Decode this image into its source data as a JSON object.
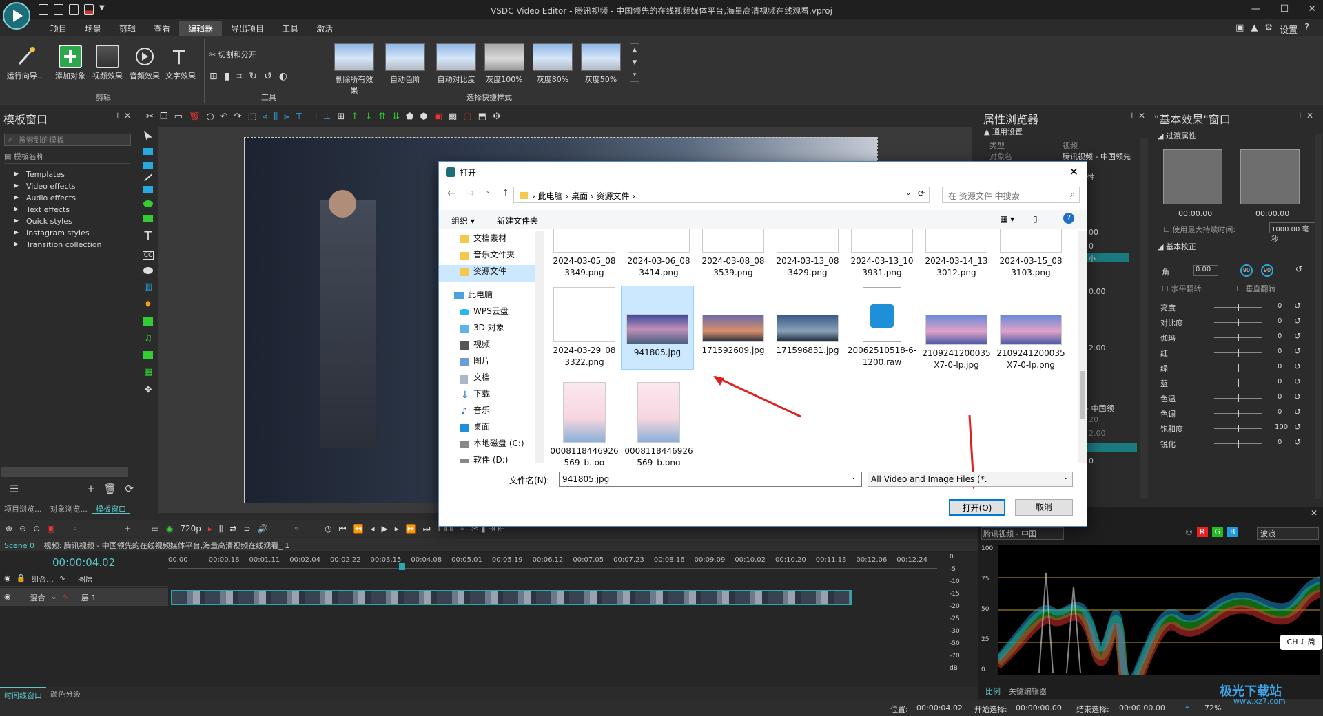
{
  "titlebar": {
    "title": "VSDC Video Editor - 腾讯视频 - 中国领先的在线视频媒体平台,海量高清视频在线观看.vproj",
    "settings": "设置"
  },
  "menu": [
    {
      "label": "项目"
    },
    {
      "label": "场景"
    },
    {
      "label": "剪辑"
    },
    {
      "label": "查看"
    },
    {
      "label": "编辑器"
    },
    {
      "label": "导出项目"
    },
    {
      "label": "工具"
    },
    {
      "label": "激活"
    }
  ],
  "ribbon": {
    "wizard": "运行向导...",
    "add_object": "添加对象",
    "video_effects": "视频效果",
    "audio_effects": "音频效果",
    "text_effects": "文字效果",
    "edit_group": "剪辑",
    "cut_split": "切割和分开",
    "tools_group": "工具",
    "styles_group": "选择快捷样式",
    "styles": [
      {
        "label": "删除所有效果"
      },
      {
        "label": "自动色阶"
      },
      {
        "label": "自动对比度"
      },
      {
        "label": "灰度100%"
      },
      {
        "label": "灰度80%"
      },
      {
        "label": "灰度50%"
      }
    ]
  },
  "template_panel": {
    "title": "模板窗口",
    "search_placeholder": "搜索到的模板",
    "column": "模板名称",
    "items": [
      {
        "label": "Templates"
      },
      {
        "label": "Video effects"
      },
      {
        "label": "Audio effects"
      },
      {
        "label": "Text effects"
      },
      {
        "label": "Quick styles"
      },
      {
        "label": "Instagram styles"
      },
      {
        "label": "Transition collection"
      }
    ],
    "tabs": [
      "项目浏览...",
      "对象浏览...",
      "模板窗口"
    ]
  },
  "properties": {
    "title": "属性浏览器",
    "section": "通用设置",
    "k1": "类型",
    "v1": "视频",
    "k2": "对象名",
    "v2": "腾讯视频 - 中国领先",
    "v3": "性",
    "t1": "00",
    "t2": "0",
    "t3": "小",
    "t4": "0.00",
    "t5": "2.00",
    "t6": "- 中国领",
    "t7": "20",
    "t8": "2.00",
    "t9": "0"
  },
  "basic_effects": {
    "title": "\"基本效果\"窗口",
    "transition": "过渡属性",
    "time1": "00:00.00",
    "time2": "00:00.00",
    "max_label": "使用最大持续时间:",
    "max_value": "1000.00 毫秒",
    "correction": "基本校正",
    "angle_label": "角",
    "angle_value": "0.00",
    "r1": "90",
    "r2": "90",
    "flip_h": "水平翻转",
    "flip_v": "垂直翻转",
    "sliders": [
      {
        "label": "亮度",
        "value": "0"
      },
      {
        "label": "对比度",
        "value": "0"
      },
      {
        "label": "伽玛",
        "value": "0"
      },
      {
        "label": "红",
        "value": "0"
      },
      {
        "label": "绿",
        "value": "0"
      },
      {
        "label": "蓝",
        "value": "0"
      },
      {
        "label": "色温",
        "value": "0"
      },
      {
        "label": "色调",
        "value": "0"
      },
      {
        "label": "饱和度",
        "value": "100"
      },
      {
        "label": "锐化",
        "value": "0"
      }
    ]
  },
  "timeline": {
    "resolution": "720p",
    "scene": "Scene 0",
    "clip_title": "视频: 腾讯视频 - 中国领先的在线视频媒体平台,海量高清视频在线观看_ 1",
    "timecode": "00:00:04.02",
    "ticks": [
      "00.00",
      "00:00.18",
      "00:01.11",
      "00:02.04",
      "00:02.22",
      "00:03.15",
      "00:04.08",
      "00:05.01",
      "00:05.19",
      "00:06.12",
      "00:07.05",
      "00:07.23",
      "00:08.16",
      "00:09.09",
      "00:10.02",
      "00:10.20",
      "00:11.13",
      "00:12.06",
      "00:12.24"
    ],
    "track1_label": "组合...",
    "track1_layer": "图层",
    "track2_mode": "混合",
    "track2_layer": "层 1",
    "db": [
      "0",
      "-5",
      "-10",
      "-15",
      "-20",
      "-25",
      "-30",
      "-50",
      "-70",
      "dB"
    ],
    "bottom_tabs": [
      "时间线窗口",
      "颜色分级"
    ]
  },
  "scope": {
    "source": "腾讯视频 - 中国",
    "r": "R",
    "g": "G",
    "b": "B",
    "mode": "波浪",
    "axis": [
      "100",
      "75",
      "50",
      "25",
      "0"
    ],
    "tabs": [
      "比例",
      "关键编辑器"
    ],
    "ime": "CH ♪ 简"
  },
  "status": {
    "position_label": "位置:",
    "position": "00:00:04.02",
    "start_label": "开始选择:",
    "start": "00:00:00.00",
    "end_label": "结束选择:",
    "end": "00:00:00.00",
    "zoom": "72%"
  },
  "dialog": {
    "title": "打开",
    "path": [
      "此电脑",
      "桌面",
      "资源文件"
    ],
    "search_placeholder": "在 资源文件 中搜索",
    "organize": "组织",
    "new_folder": "新建文件夹",
    "nav": [
      {
        "label": "文档素材"
      },
      {
        "label": "音乐文件夹"
      },
      {
        "label": "资源文件"
      },
      {
        "label": "此电脑"
      },
      {
        "label": "WPS云盘"
      },
      {
        "label": "3D 对象"
      },
      {
        "label": "视频"
      },
      {
        "label": "图片"
      },
      {
        "label": "文档"
      },
      {
        "label": "下载"
      },
      {
        "label": "音乐"
      },
      {
        "label": "桌面"
      },
      {
        "label": "本地磁盘 (C:)"
      },
      {
        "label": "软件 (D:)"
      }
    ],
    "files": [
      {
        "l1": "2024-03-05_08",
        "l2": "3349.png"
      },
      {
        "l1": "2024-03-06_08",
        "l2": "3414.png"
      },
      {
        "l1": "2024-03-08_08",
        "l2": "3539.png"
      },
      {
        "l1": "2024-03-13_08",
        "l2": "3429.png"
      },
      {
        "l1": "2024-03-13_10",
        "l2": "3931.png"
      },
      {
        "l1": "2024-03-14_13",
        "l2": "3012.png"
      },
      {
        "l1": "2024-03-15_08",
        "l2": "3103.png"
      },
      {
        "l1": "2024-03-29_08",
        "l2": "3322.png"
      },
      {
        "l1": "941805.jpg",
        "l2": ""
      },
      {
        "l1": "171592609.jpg",
        "l2": ""
      },
      {
        "l1": "171596831.jpg",
        "l2": ""
      },
      {
        "l1": "20062510518-6-",
        "l2": "1200.raw"
      },
      {
        "l1": "2109241200035",
        "l2": "X7-0-lp.jpg"
      },
      {
        "l1": "2109241200035",
        "l2": "X7-0-lp.png"
      },
      {
        "l1": "0008118446926",
        "l2": "569_b.jpg"
      },
      {
        "l1": "0008118446926",
        "l2": "569_b.png"
      }
    ],
    "filename_label": "文件名(N):",
    "filename": "941805.jpg",
    "filter": "All Video and Image Files (*.",
    "open": "打开(O)",
    "cancel": "取消"
  },
  "watermark": "极光下载站",
  "watermark_url": "www.xz7.com"
}
